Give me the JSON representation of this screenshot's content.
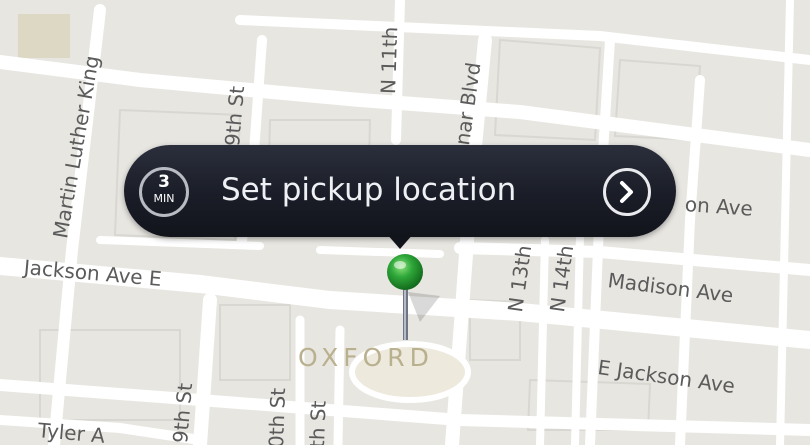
{
  "map": {
    "city_label": "OXFORD",
    "streets": {
      "mlk": "Martin Luther King",
      "n9th": "9th St",
      "n11th": "N 11th",
      "lamar": "nar Blvd",
      "jackson_e": "Jackson Ave E",
      "van_buren": "on Ave",
      "n13th": "N 13th",
      "n14th": "N 14th",
      "madison": "Madison Ave",
      "e_jackson": "E Jackson Ave",
      "s9th": "9th St",
      "s10th": "0th St",
      "s11th": "th St",
      "tyler": "Tyler A"
    },
    "colors": {
      "background": "#e8e6e1",
      "road": "#ffffff",
      "park": "#ddd8c4",
      "pin_head": "#2fa83a"
    }
  },
  "pickup_callout": {
    "eta_value": "3",
    "eta_unit": "MIN",
    "text": "Set pickup location",
    "action_icon": "chevron-right-icon",
    "colors": {
      "bubble": "#1a1d27",
      "text": "#eef0f4"
    }
  }
}
